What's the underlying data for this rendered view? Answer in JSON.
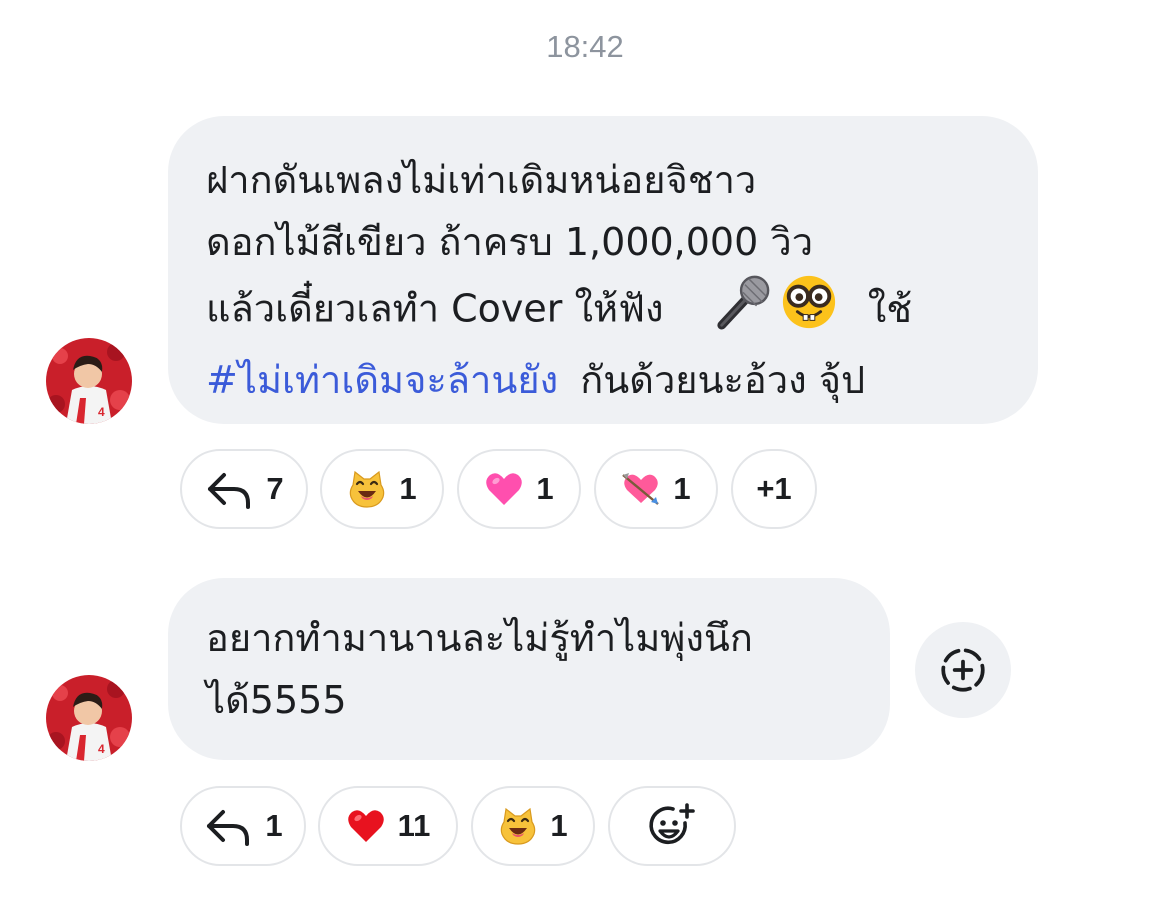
{
  "timestamp": "18:42",
  "messages": [
    {
      "lines": [
        "ฝากดันเพลงไม่เท่าเดิมหน่อยจิชาว",
        "ดอกไม้สีเขียว ถ้าครบ 1,000,000 วิว",
        "แล้วเดี๋ยวเลทำ Cover ให้ฟัง",
        "ใช้",
        "#ไม่เท่าเดิมจะล้านยัง",
        "กันด้วยนะอ้วง จุ้ป"
      ],
      "inline_icons": [
        "microphone-emoji",
        "nerd-face-emoji"
      ],
      "reactions": {
        "reply_count": "7",
        "items": [
          {
            "icon": "smiling-cat-emoji",
            "count": "1"
          },
          {
            "icon": "pink-heart-emoji",
            "count": "1"
          },
          {
            "icon": "heart-with-arrow-emoji",
            "count": "1"
          }
        ],
        "more": "+1"
      }
    },
    {
      "lines": [
        "อยากทำมานานละไม่รู้ทำไมพุ่งนึก",
        "ได้5555"
      ],
      "reactions": {
        "reply_count": "1",
        "items": [
          {
            "icon": "red-heart-emoji",
            "count": "11"
          },
          {
            "icon": "smiling-cat-emoji",
            "count": "1"
          }
        ]
      }
    }
  ],
  "icons": {
    "reply": "reply-arrow-icon",
    "add_reaction": "add-reaction-icon",
    "add_message": "dashed-plus-icon"
  },
  "colors": {
    "bubble_bg": "#eff1f4",
    "hashtag": "#3b5bd9",
    "timestamp": "#8d949e"
  }
}
